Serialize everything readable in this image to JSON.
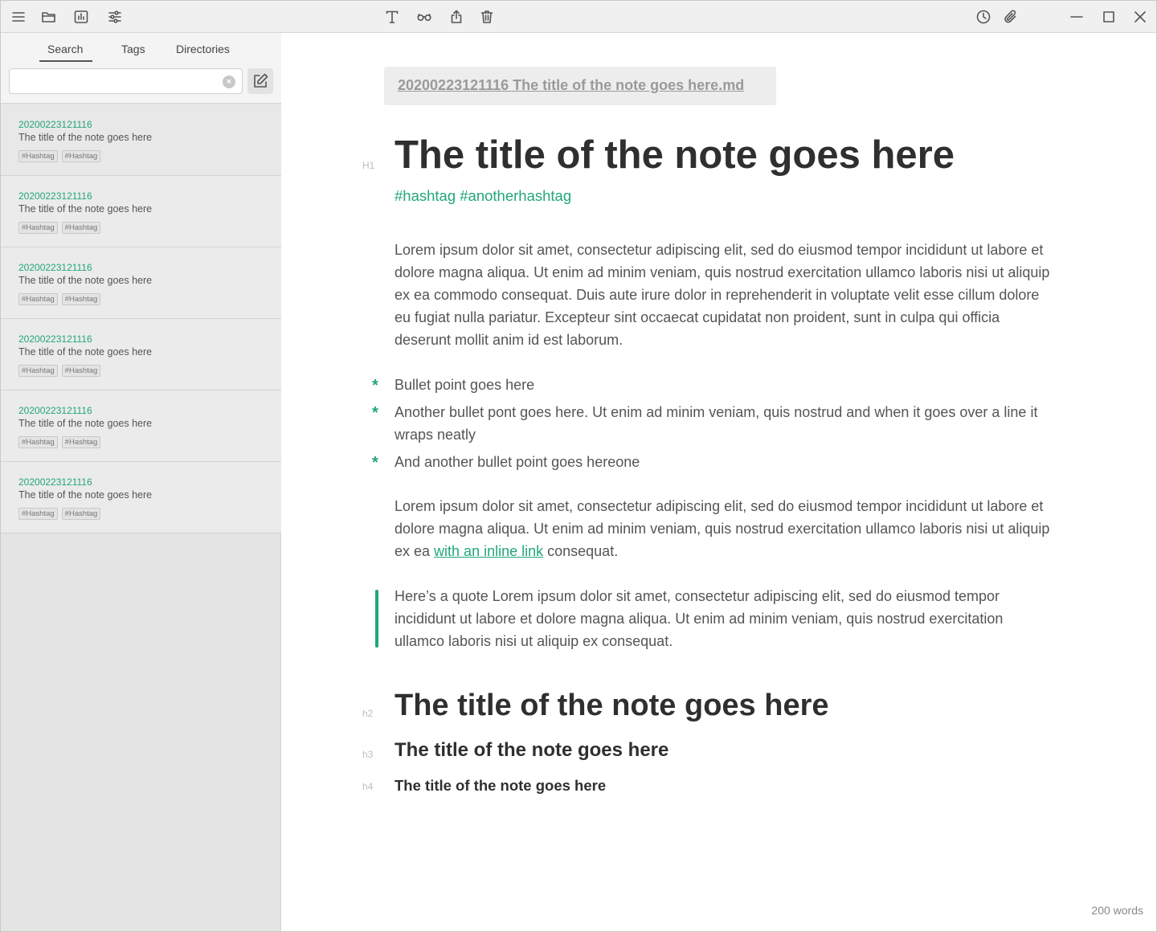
{
  "toolbar": {
    "left_icons": [
      "menu-icon",
      "folder-open-icon",
      "chart-icon",
      "sliders-icon"
    ],
    "center_icons": [
      "text-format-icon",
      "glasses-icon",
      "share-icon",
      "trash-icon"
    ],
    "right_icons": [
      "history-icon",
      "attachment-icon"
    ],
    "window_controls": [
      "minimize-icon",
      "maximize-icon",
      "close-icon"
    ]
  },
  "sidebar": {
    "tabs": [
      {
        "label": "Search",
        "active": true
      },
      {
        "label": "Tags",
        "active": false
      },
      {
        "label": "Directories",
        "active": false
      }
    ],
    "search": {
      "value": "",
      "placeholder": ""
    },
    "notes": [
      {
        "id": "20200223121116",
        "title": "The title of the note goes here",
        "tags": [
          "#Hashtag",
          "#Hashtag"
        ]
      },
      {
        "id": "20200223121116",
        "title": "The title of the note goes here",
        "tags": [
          "#Hashtag",
          "#Hashtag"
        ]
      },
      {
        "id": "20200223121116",
        "title": "The title of the note goes here",
        "tags": [
          "#Hashtag",
          "#Hashtag"
        ]
      },
      {
        "id": "20200223121116",
        "title": "The title of the note goes here",
        "tags": [
          "#Hashtag",
          "#Hashtag"
        ]
      },
      {
        "id": "20200223121116",
        "title": "The title of the note goes here",
        "tags": [
          "#Hashtag",
          "#Hashtag"
        ]
      },
      {
        "id": "20200223121116",
        "title": "The title of the note goes here",
        "tags": [
          "#Hashtag",
          "#Hashtag"
        ]
      }
    ]
  },
  "editor": {
    "filename": "20200223121116 The title of the note goes here.md",
    "gutter": {
      "h1": "H1",
      "h2": "h2",
      "h3": "h3",
      "h4": "h4"
    },
    "h1": "The title of the note goes here",
    "hashtags": "#hashtag #anotherhashtag",
    "paragraph1": "Lorem ipsum dolor sit amet, consectetur adipiscing elit, sed do eiusmod tempor incididunt ut labore et dolore magna aliqua. Ut enim ad minim veniam, quis nostrud exercitation ullamco laboris nisi ut aliquip ex ea commodo consequat. Duis aute irure dolor in reprehenderit in voluptate velit esse cillum dolore eu fugiat nulla pariatur. Excepteur sint occaecat cupidatat non proident, sunt in culpa qui officia deserunt mollit anim id est laborum.",
    "bullet_marker": "*",
    "bullets": [
      "Bullet point goes here",
      "Another bullet pont goes here. Ut enim ad minim veniam, quis nostrud and when it goes over a line it wraps neatly",
      "And another bullet point goes hereone"
    ],
    "paragraph2_before": "Lorem ipsum dolor sit amet, consectetur adipiscing elit, sed do eiusmod tempor incididunt ut labore et dolore magna aliqua. Ut enim ad minim veniam, quis nostrud exercitation ullamco laboris nisi ut aliquip ex ea ",
    "paragraph2_link": "with an inline link",
    "paragraph2_after": " consequat.",
    "quote": "Here’s a quote Lorem ipsum dolor sit amet, consectetur adipiscing elit, sed do eiusmod tempor incididunt ut labore et dolore magna aliqua. Ut enim ad minim veniam, quis nostrud exercitation ullamco laboris nisi ut aliquip ex consequat.",
    "h2": "The title of the note goes here",
    "h3": "The title of the note goes here",
    "h4": "The title of the note goes here",
    "word_count": "200 words"
  },
  "colors": {
    "accent": "#22a67a",
    "sidebar_bg": "#e4e4e4",
    "toolbar_bg": "#f0f0f0"
  }
}
